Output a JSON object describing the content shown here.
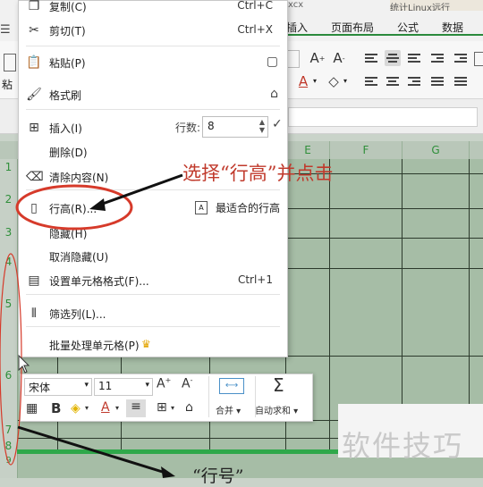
{
  "window": {
    "title_fragment": "xcx",
    "side_title": "统计Linux远行"
  },
  "ribbon": {
    "tabs": [
      "插入",
      "页面布局",
      "公式",
      "数据"
    ],
    "paste_label_partial": "粘",
    "font_size_up_icon": "A⁺",
    "font_size_down_icon": "A⁻"
  },
  "sheet": {
    "columns": [
      "E",
      "F",
      "G"
    ],
    "rows": [
      "1",
      "2",
      "3",
      "4",
      "5",
      "6",
      "7",
      "8",
      "9"
    ]
  },
  "context_menu": {
    "items": [
      {
        "label": "复制(C)",
        "shortcut": "Ctrl+C",
        "icon": "copy-icon"
      },
      {
        "label": "剪切(T)",
        "shortcut": "Ctrl+X",
        "icon": "scissors-icon"
      },
      {
        "label": "粘贴(P)",
        "shortcut": "",
        "icon": "paste-icon"
      },
      {
        "label": "格式刷",
        "shortcut": "",
        "icon": "format-brush-icon"
      },
      {
        "label": "插入(I)",
        "shortcut": "",
        "icon": "insert-icon"
      },
      {
        "label": "删除(D)",
        "shortcut": "",
        "icon": ""
      },
      {
        "label": "清除内容(N)",
        "shortcut": "",
        "icon": "eraser-icon"
      },
      {
        "label": "行高(R)...",
        "shortcut": "",
        "icon": "row-height-icon"
      },
      {
        "label": "隐藏(H)",
        "shortcut": "",
        "icon": ""
      },
      {
        "label": "取消隐藏(U)",
        "shortcut": "",
        "icon": ""
      },
      {
        "label": "设置单元格格式(F)...",
        "shortcut": "Ctrl+1",
        "icon": "format-cells-icon"
      },
      {
        "label": "筛选列(L)...",
        "shortcut": "",
        "icon": "filter-columns-icon"
      },
      {
        "label": "批量处理单元格(P)",
        "shortcut": "",
        "icon": ""
      }
    ],
    "rows_label": "行数:",
    "rows_value": "8",
    "fit_row_label": "最适合的行高"
  },
  "mini_toolbar": {
    "font_name": "宋体",
    "font_size": "11",
    "merge_label": "合并",
    "autosum_label": "自动求和",
    "bold_label": "B"
  },
  "annotation": {
    "instruction": "选择“行高”并点击",
    "bottom_note": "“行号”"
  },
  "watermark": "软件技巧",
  "colors": {
    "accent_red": "#c0392b",
    "grid_green": "#a6bda6",
    "header_green": "#2f8f3a"
  }
}
